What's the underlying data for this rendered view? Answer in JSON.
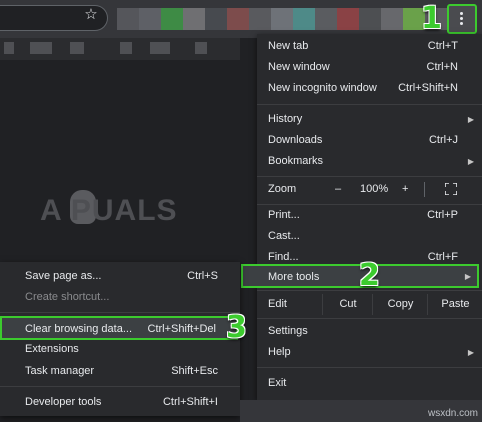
{
  "toolbar": {
    "star_icon": "star-icon",
    "menu_icon": "three-dot-menu-icon",
    "tile_colors": [
      "#55565b",
      "#5e6066",
      "#3e8b45",
      "#6f6f72",
      "#474a4f",
      "#7d4c4c",
      "#595a5e",
      "#6e7278",
      "#4e8a88",
      "#5a5c60",
      "#8a4245",
      "#4d4f52",
      "#67686c",
      "#6aa14a",
      "#5a5b5e"
    ]
  },
  "watermark": {
    "text": "A PUALS"
  },
  "steps": {
    "one": "1",
    "two": "2",
    "three": "3"
  },
  "menu": {
    "new_tab": {
      "label": "New tab",
      "shortcut": "Ctrl+T"
    },
    "new_window": {
      "label": "New window",
      "shortcut": "Ctrl+N"
    },
    "incognito": {
      "label": "New incognito window",
      "shortcut": "Ctrl+Shift+N"
    },
    "history": {
      "label": "History"
    },
    "downloads": {
      "label": "Downloads",
      "shortcut": "Ctrl+J"
    },
    "bookmarks": {
      "label": "Bookmarks"
    },
    "zoom": {
      "label": "Zoom",
      "minus": "–",
      "value": "100%",
      "plus": "+"
    },
    "print": {
      "label": "Print...",
      "shortcut": "Ctrl+P"
    },
    "cast": {
      "label": "Cast..."
    },
    "find": {
      "label": "Find...",
      "shortcut": "Ctrl+F"
    },
    "more_tools": {
      "label": "More tools"
    },
    "edit": {
      "label": "Edit",
      "cut": "Cut",
      "copy": "Copy",
      "paste": "Paste"
    },
    "settings": {
      "label": "Settings"
    },
    "help": {
      "label": "Help"
    },
    "exit": {
      "label": "Exit"
    }
  },
  "submenu": {
    "save_page": {
      "label": "Save page as...",
      "shortcut": "Ctrl+S"
    },
    "create_shortcut": {
      "label": "Create shortcut..."
    },
    "clear_browsing": {
      "label": "Clear browsing data...",
      "shortcut": "Ctrl+Shift+Del"
    },
    "extensions": {
      "label": "Extensions"
    },
    "task_manager": {
      "label": "Task manager",
      "shortcut": "Shift+Esc"
    },
    "dev_tools": {
      "label": "Developer tools",
      "shortcut": "Ctrl+Shift+I"
    }
  },
  "brand": "wsxdn.com",
  "colors": {
    "highlight": "#3ccb2e",
    "menu_bg": "#292a2d",
    "page_bg": "#202124"
  }
}
